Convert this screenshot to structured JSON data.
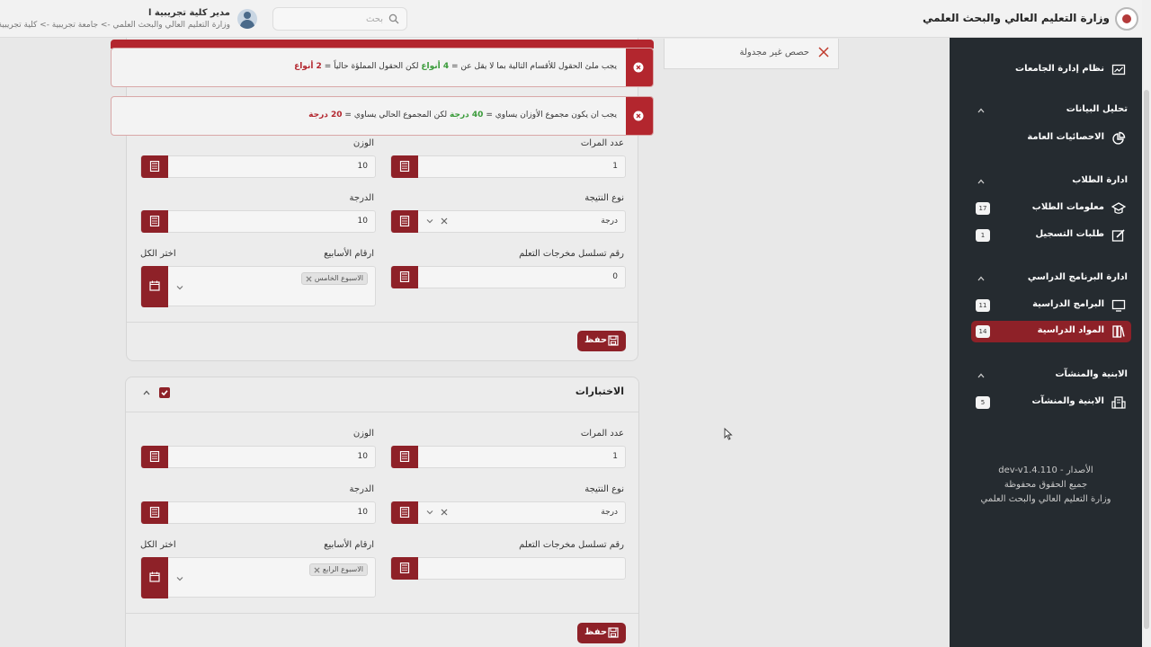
{
  "header": {
    "user_name": "مدير كلية تجريبية ا",
    "user_org": "وزارة التعليم العالي والبحث العلمي -> جامعة تجريبية -> كلية تجريبية",
    "search_placeholder": "بحث",
    "ministry_title": "وزارة التعليم العالي والبحث العلمي"
  },
  "sidebar": {
    "top_item": {
      "label": "نظام إدارة الجامعات"
    },
    "sections": [
      {
        "title": "تحليل البيانات",
        "items": [
          {
            "label": "الاحصائيات العامة"
          }
        ]
      },
      {
        "title": "ادارة الطلاب",
        "items": [
          {
            "label": "معلومات الطلاب",
            "badge": "17"
          },
          {
            "label": "طلبات التسجيل",
            "badge": "1"
          }
        ]
      },
      {
        "title": "ادارة البرنامج الدراسي",
        "items": [
          {
            "label": "البرامج الدراسية",
            "badge": "11"
          },
          {
            "label": "المواد الدراسية",
            "badge": "14"
          }
        ]
      },
      {
        "title": "الابنية والمنشآت",
        "items": [
          {
            "label": "الابنية والمنشآت",
            "badge": "5"
          }
        ]
      }
    ],
    "footer": {
      "version": "dev-v1.4.110 - الأصدار",
      "rights": "جميع الحقوق محفوظة",
      "owner": "وزارة التعليم العالي والبحث العلمي"
    }
  },
  "unscheduled": {
    "label": "حصص غير مجدولة"
  },
  "alerts": [
    {
      "prefix": "يجب ملئ الحقول للأقسام التالية بما لا يقل عن =",
      "required": "4 أنواع",
      "middle": "لكن الحقول المملؤة حالياً =",
      "current": "2 أنواع"
    },
    {
      "prefix": "يجب ان يكون مجموع الأوزان يساوي =",
      "required": "40 درجة",
      "middle": "لكن المجموع الحالي يساوي =",
      "current": "20 درجة"
    }
  ],
  "form_top": {
    "count_label": "عدد المرات",
    "count_value": "1",
    "weight_label": "الوزن",
    "weight_value": "10",
    "result_type_label": "نوع النتيجة",
    "result_type_value": "درجة",
    "grade_label": "الدرجة",
    "grade_value": "10",
    "outcomes_label": "رقم تسلسل مخرجات التعلم",
    "outcomes_value": "0",
    "weeks_label": "ارقام الأسابيع",
    "week_tag": "الاسبوع الخامس",
    "select_all": "اختر الكل",
    "save_label": "حفظ"
  },
  "section_exams": {
    "title": "الاختبارات",
    "count_label": "عدد المرات",
    "count_value": "1",
    "weight_label": "الوزن",
    "weight_value": "10",
    "result_type_label": "نوع النتيجة",
    "result_type_value": "درجة",
    "grade_label": "الدرجة",
    "grade_value": "10",
    "outcomes_label": "رقم تسلسل مخرجات التعلم",
    "outcomes_value": "",
    "weeks_label": "ارقام الأسابيع",
    "week_tag": "الاسبوع الرابع",
    "select_all": "اختر الكل",
    "save_label": "حفظ"
  },
  "colors": {
    "brand": "#8e2128",
    "alert": "#b3262e",
    "success": "#3a9b3a",
    "sidebar_bg": "#252b30"
  }
}
